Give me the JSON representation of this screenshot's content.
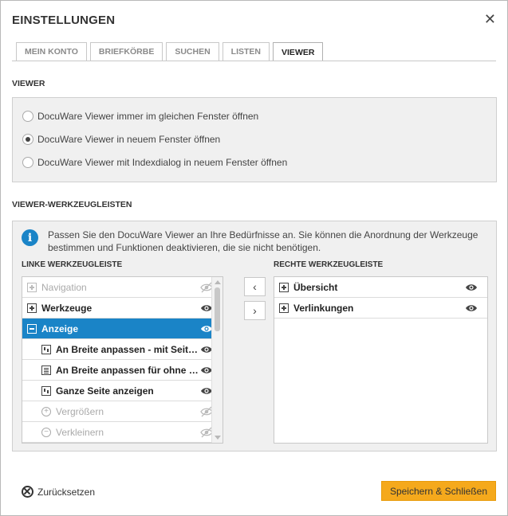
{
  "dialog": {
    "title": "EINSTELLUNGEN",
    "close_icon": "close-icon"
  },
  "tabs": [
    {
      "label": "MEIN KONTO",
      "active": false
    },
    {
      "label": "BRIEFKÖRBE",
      "active": false
    },
    {
      "label": "SUCHEN",
      "active": false
    },
    {
      "label": "LISTEN",
      "active": false
    },
    {
      "label": "VIEWER",
      "active": true
    }
  ],
  "viewer_section": {
    "title": "VIEWER",
    "options": [
      {
        "label": "DocuWare Viewer immer im gleichen Fenster öffnen",
        "checked": false
      },
      {
        "label": "DocuWare Viewer in neuem Fenster öffnen",
        "checked": true
      },
      {
        "label": "DocuWare Viewer mit Indexdialog in neuem Fenster öffnen",
        "checked": false
      }
    ]
  },
  "toolbars_section": {
    "title": "VIEWER-WERKZEUGLEISTEN",
    "info_text": "Passen Sie den DocuWare Viewer an Ihre Bedürfnisse an. Sie können die Anordnung der Werkzeuge bestimmen und Funktionen deaktivieren, die sie nicht benötigen.",
    "left_title": "LINKE WERKZEUGLEISTE",
    "right_title": "RECHTE WERKZEUGLEISTE",
    "left_items": [
      {
        "label": "Navigation",
        "icon": "plus-icon",
        "visible": false,
        "level": 0,
        "state": "dim"
      },
      {
        "label": "Werkzeuge",
        "icon": "plus-icon",
        "visible": true,
        "level": 0,
        "state": "main"
      },
      {
        "label": "Anzeige",
        "icon": "minus-icon",
        "visible": true,
        "level": 0,
        "state": "selected"
      },
      {
        "label": "An Breite anpassen - mit Seitenrand",
        "icon": "fit-width-icon",
        "visible": true,
        "level": 1,
        "state": "main"
      },
      {
        "label": "An Breite anpassen für ohne Seitenrand",
        "icon": "fit-page-icon",
        "visible": true,
        "level": 1,
        "state": "main"
      },
      {
        "label": "Ganze Seite anzeigen",
        "icon": "fit-width-icon",
        "visible": true,
        "level": 1,
        "state": "main"
      },
      {
        "label": "Vergrößern",
        "icon": "zoom-in-icon",
        "visible": false,
        "level": 1,
        "state": "dim"
      },
      {
        "label": "Verkleinern",
        "icon": "zoom-out-icon",
        "visible": false,
        "level": 1,
        "state": "dim"
      }
    ],
    "right_items": [
      {
        "label": "Übersicht",
        "icon": "plus-icon",
        "visible": true
      },
      {
        "label": "Verlinkungen",
        "icon": "plus-icon",
        "visible": true
      }
    ],
    "move_left_label": "‹",
    "move_right_label": "›"
  },
  "footer": {
    "reset_label": "Zurücksetzen",
    "save_label": "Speichern & Schließen"
  },
  "colors": {
    "accent": "#1a84c7",
    "primary_button": "#f5a91c"
  }
}
